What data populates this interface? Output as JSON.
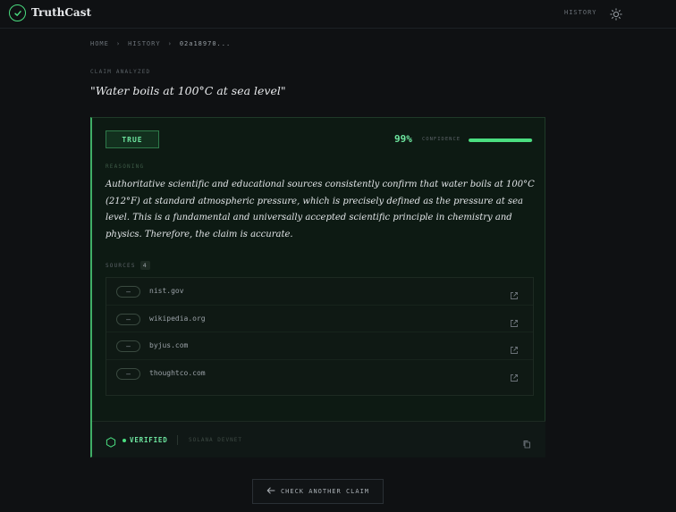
{
  "app": {
    "name": "TruthCast"
  },
  "nav": {
    "history": "HISTORY"
  },
  "breadcrumb": [
    "HOME",
    "HISTORY",
    "02a18970..."
  ],
  "claim": {
    "label": "CLAIM ANALYZED",
    "text": "\"Water boils at 100°C at sea level\""
  },
  "result": {
    "verdict": "TRUE",
    "confidence_text": "99%",
    "confidence_value": 99,
    "confidence_label": "CONFIDENCE",
    "reasoning_label": "REASONING",
    "reasoning": "Authoritative scientific and educational sources consistently confirm that water boils at 100°C (212°F) at standard atmospheric pressure, which is precisely defined as the pressure at sea level. This is a fundamental and universally accepted scientific principle in chemistry and physics. Therefore, the claim is accurate."
  },
  "sources": {
    "label": "SOURCES",
    "count": "4",
    "items": [
      {
        "stance": "—",
        "domain": "nist.gov"
      },
      {
        "stance": "—",
        "domain": "wikipedia.org"
      },
      {
        "stance": "—",
        "domain": "byjus.com"
      },
      {
        "stance": "—",
        "domain": "thoughtco.com"
      }
    ]
  },
  "footer": {
    "verified": "VERIFIED",
    "network": "SOLANA DEVNET"
  },
  "actions": {
    "check_another": "CHECK ANOTHER CLAIM"
  },
  "colors": {
    "accent": "#4ade80",
    "background": "#0f1113",
    "card": "#0d1a13"
  }
}
